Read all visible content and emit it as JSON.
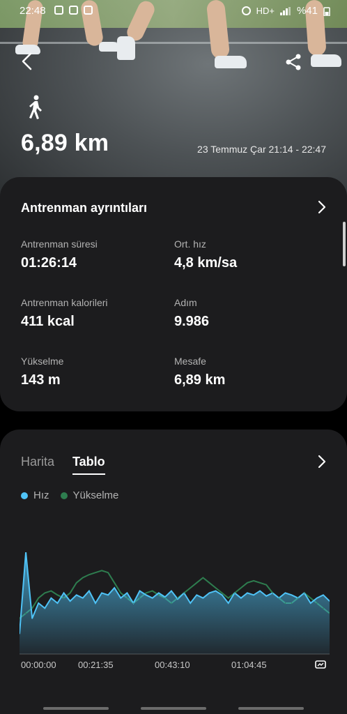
{
  "status_bar": {
    "time": "22:48",
    "network": "HD+",
    "battery": "%41"
  },
  "header": {
    "activity_icon": "walking-person-icon",
    "distance": "6,89 km",
    "date_range": "23 Temmuz Çar 21:14 - 22:47"
  },
  "details_card": {
    "title": "Antrenman ayrıntıları",
    "stats": [
      {
        "label": "Antrenman süresi",
        "value": "01:26:14"
      },
      {
        "label": "Ort. hız",
        "value": "4,8 km/sa"
      },
      {
        "label": "Antrenman kalorileri",
        "value": "411 kcal"
      },
      {
        "label": "Adım",
        "value": "9.986"
      },
      {
        "label": "Yükselme",
        "value": "143 m"
      },
      {
        "label": "Mesafe",
        "value": "6,89 km"
      }
    ]
  },
  "chart_card": {
    "tabs": [
      "Harita",
      "Tablo"
    ],
    "active_tab": "Tablo",
    "legend": [
      {
        "name": "Hız",
        "color": "#4fc3f7"
      },
      {
        "name": "Yükselme",
        "color": "#2e7d4f"
      }
    ],
    "time_labels": [
      "00:00:00",
      "00:21:35",
      "00:43:10",
      "01:04:45"
    ]
  },
  "chart_data": {
    "type": "area",
    "x_tick_labels": [
      "00:00:00",
      "00:21:35",
      "00:43:10",
      "01:04:45"
    ],
    "series": [
      {
        "name": "Hız",
        "color": "#4fc3f7",
        "values": [
          0.2,
          1.0,
          0.35,
          0.5,
          0.45,
          0.55,
          0.5,
          0.6,
          0.52,
          0.58,
          0.55,
          0.62,
          0.5,
          0.6,
          0.58,
          0.65,
          0.55,
          0.6,
          0.5,
          0.62,
          0.58,
          0.55,
          0.6,
          0.56,
          0.62,
          0.54,
          0.6,
          0.5,
          0.58,
          0.55,
          0.6,
          0.62,
          0.58,
          0.5,
          0.6,
          0.55,
          0.6,
          0.58,
          0.62,
          0.57,
          0.6,
          0.55,
          0.6,
          0.58,
          0.55,
          0.6,
          0.5,
          0.55,
          0.58,
          0.52
        ]
      },
      {
        "name": "Yükselme",
        "color": "#2e7d4f",
        "values": [
          0.35,
          0.4,
          0.45,
          0.55,
          0.6,
          0.62,
          0.58,
          0.55,
          0.6,
          0.7,
          0.75,
          0.78,
          0.8,
          0.82,
          0.8,
          0.7,
          0.6,
          0.55,
          0.5,
          0.55,
          0.6,
          0.62,
          0.58,
          0.55,
          0.5,
          0.55,
          0.6,
          0.65,
          0.7,
          0.75,
          0.7,
          0.65,
          0.6,
          0.55,
          0.6,
          0.65,
          0.7,
          0.72,
          0.7,
          0.68,
          0.6,
          0.55,
          0.5,
          0.5,
          0.55,
          0.6,
          0.55,
          0.5,
          0.45,
          0.4
        ]
      }
    ]
  }
}
